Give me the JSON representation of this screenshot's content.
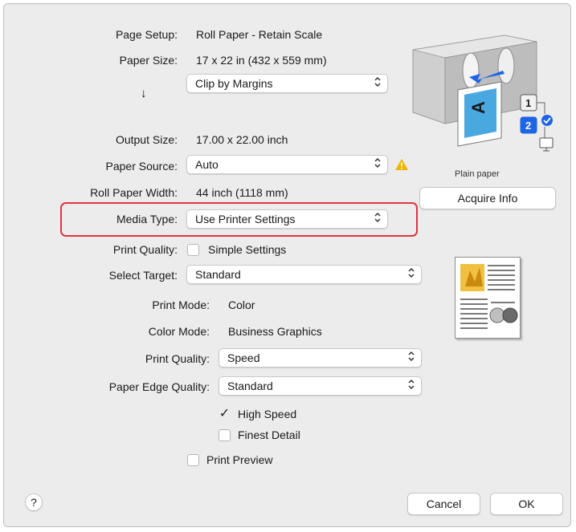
{
  "page_setup": {
    "label": "Page Setup:",
    "value": "Roll Paper - Retain Scale"
  },
  "paper_size": {
    "label": "Paper Size:",
    "value": "17 x 22 in (432 x 559 mm)"
  },
  "scaling": {
    "arrow": "↓",
    "value": "Clip by Margins"
  },
  "output_size": {
    "label": "Output Size:",
    "value": "17.00 x 22.00 inch"
  },
  "paper_source": {
    "label": "Paper Source:",
    "value": "Auto",
    "warning_color": "#f0b400"
  },
  "roll_paper_width": {
    "label": "Roll Paper Width:",
    "value": "44 inch (1118 mm)"
  },
  "media_type": {
    "label": "Media Type:",
    "value": "Use Printer Settings",
    "highlight_color": "#e0343e"
  },
  "print_quality_top": {
    "label": "Print Quality:",
    "checkbox_label": "Simple Settings",
    "checked": false
  },
  "select_target": {
    "label": "Select Target:",
    "value": "Standard"
  },
  "print_mode": {
    "label": "Print Mode:",
    "value": "Color"
  },
  "color_mode": {
    "label": "Color Mode:",
    "value": "Business Graphics"
  },
  "print_quality": {
    "label": "Print Quality:",
    "value": "Speed"
  },
  "paper_edge_quality": {
    "label": "Paper Edge Quality:",
    "value": "Standard"
  },
  "high_speed": {
    "label": "High Speed",
    "checked": true
  },
  "finest_detail": {
    "label": "Finest Detail",
    "checked": false
  },
  "print_preview": {
    "label": "Print Preview",
    "checked": false
  },
  "printer_preview": {
    "caption": "Plain paper",
    "tray_numbers": [
      "1",
      "2"
    ],
    "sheet_letter": "A"
  },
  "acquire_info": {
    "label": "Acquire Info"
  },
  "help": {
    "label": "?"
  },
  "buttons": {
    "cancel": "Cancel",
    "ok": "OK"
  },
  "icons": {
    "popup_chevron": "⌃⌄",
    "checkmark": "✓"
  },
  "colors": {
    "accent_blue": "#1e64e6",
    "panel_bg": "#ececec"
  }
}
